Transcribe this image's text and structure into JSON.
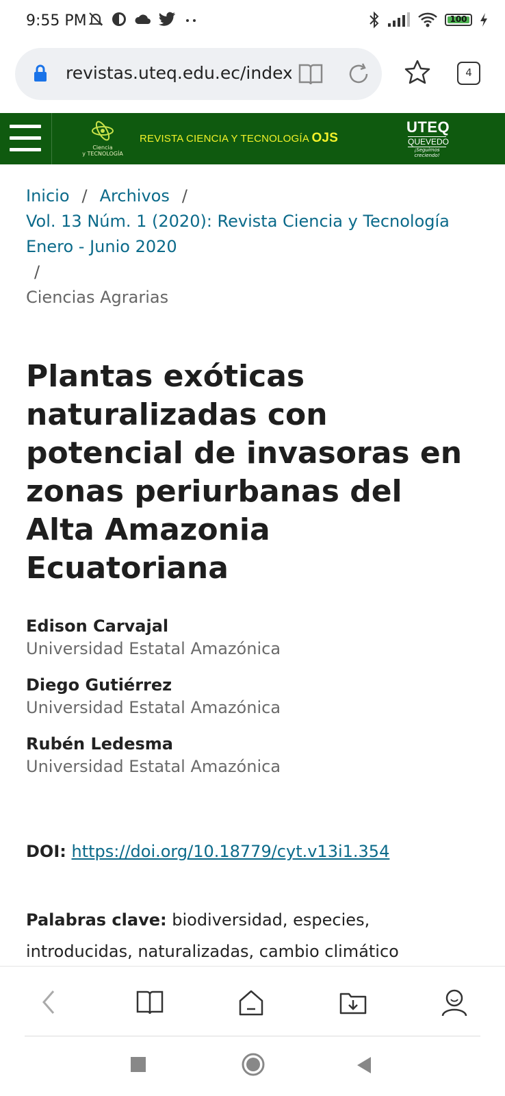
{
  "status_bar": {
    "time": "9:55 PM",
    "battery": "100",
    "left_icons": [
      "mute-icon",
      "vpn-icon",
      "cloud-icon",
      "twitter-icon",
      "more-dots-icon"
    ],
    "right_icons": [
      "bluetooth-icon",
      "signal-icon",
      "wifi-icon",
      "battery-icon",
      "charging-icon"
    ]
  },
  "browser": {
    "url": "revistas.uteq.edu.ec/index",
    "tab_count": "4"
  },
  "site_header": {
    "logo_text_1": "Ciencia",
    "logo_text_2": "y TECNOLOGÍA",
    "title": "REVISTA  CIENCIA Y TECNOLOGÍA",
    "title_suffix": "OJS",
    "uteq_1": "UTEQ",
    "uteq_2": "QUEVEDO",
    "uteq_3": "¡Seguimos creciendo!",
    "brand_color": "#0f5a0f",
    "title_color": "#f2f22a"
  },
  "breadcrumb": {
    "home": "Inicio",
    "archives": "Archivos",
    "issue": "Vol. 13 Núm. 1 (2020): Revista Ciencia y Tecnología Enero - Junio 2020",
    "separator": "/",
    "current": "Ciencias Agrarias"
  },
  "article": {
    "title": "Plantas exóticas naturalizadas con potencial de invasoras en zonas periurbanas del Alta Amazonia Ecuatoriana",
    "authors": [
      {
        "name": "Edison Carvajal",
        "affiliation": "Universidad Estatal Amazónica"
      },
      {
        "name": "Diego Gutiérrez",
        "affiliation": "Universidad Estatal Amazónica"
      },
      {
        "name": "Rubén Ledesma",
        "affiliation": "Universidad Estatal Amazónica"
      }
    ],
    "doi_label": "DOI:",
    "doi_url": "https://doi.org/10.18779/cyt.v13i1.354",
    "keywords_label": "Palabras clave:",
    "keywords": "biodiversidad, especies, introducidas, naturalizadas, cambio climático"
  },
  "bottom_toolbar": [
    "back-icon",
    "bookmarks-icon",
    "home-icon",
    "downloads-icon",
    "profile-icon"
  ],
  "system_nav": [
    "recents-icon",
    "home-nav-icon",
    "back-nav-icon"
  ]
}
